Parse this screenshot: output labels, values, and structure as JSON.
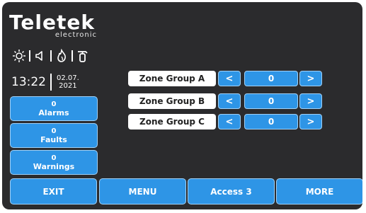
{
  "brand": {
    "name": "Teletek",
    "tagline": "electronic"
  },
  "status_icons": [
    "brightness-icon",
    "speaker-icon",
    "fire-icon",
    "extinguisher-icon"
  ],
  "clock": {
    "time": "13:22",
    "date_day_month": "02.07.",
    "date_year": "2021"
  },
  "counters": {
    "alarms": {
      "count": "0",
      "label": "Alarms"
    },
    "faults": {
      "count": "0",
      "label": "Faults"
    },
    "warnings": {
      "count": "0",
      "label": "Warnings"
    }
  },
  "zone_groups": [
    {
      "label": "Zone Group A",
      "value": "0",
      "dec": "<",
      "inc": ">"
    },
    {
      "label": "Zone Group B",
      "value": "0",
      "dec": "<",
      "inc": ">"
    },
    {
      "label": "Zone Group C",
      "value": "0",
      "dec": "<",
      "inc": ">"
    }
  ],
  "bottom_bar": {
    "exit": "EXIT",
    "menu": "MENU",
    "access": "Access 3",
    "more": "MORE"
  },
  "colors": {
    "background": "#2b2b2d",
    "button": "#2e95e6",
    "button_border": "#9fd0f7",
    "label_bg": "#ffffff"
  }
}
